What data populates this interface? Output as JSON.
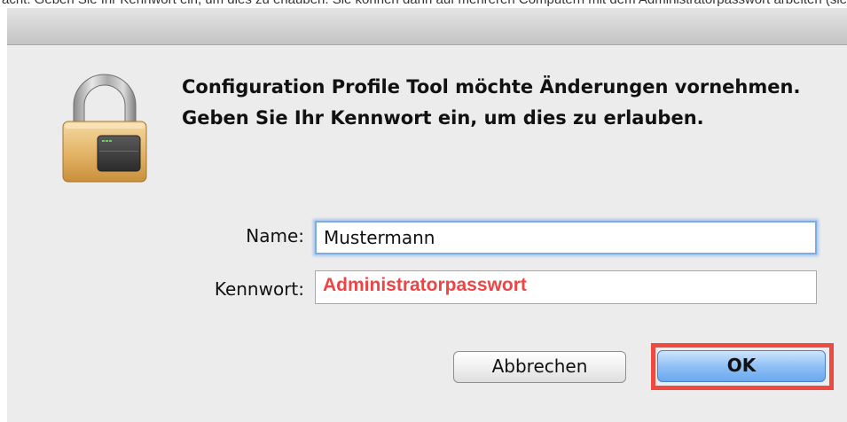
{
  "top_snippet": "acht. Geben Sie Ihr Kennwort ein, um dies zu erlauben. Sie können dann auf mehreren Computern mit dem Administratorpasswort arbeiten (siehe",
  "dialog": {
    "message": "Configuration Profile Tool möchte Änderungen vornehmen. Geben Sie Ihr Kennwort ein, um dies zu erlauben.",
    "name_label": "Name:",
    "name_value": "Mustermann",
    "password_label": "Kennwort:",
    "password_value": "Administratorpasswort",
    "cancel_label": "Abbrechen",
    "ok_label": "OK"
  },
  "colors": {
    "annotation_red": "#ef4a40",
    "password_text": "#ee4444",
    "focus_blue": "#7eaae5"
  },
  "icons": {
    "lock": "padlock-icon"
  }
}
